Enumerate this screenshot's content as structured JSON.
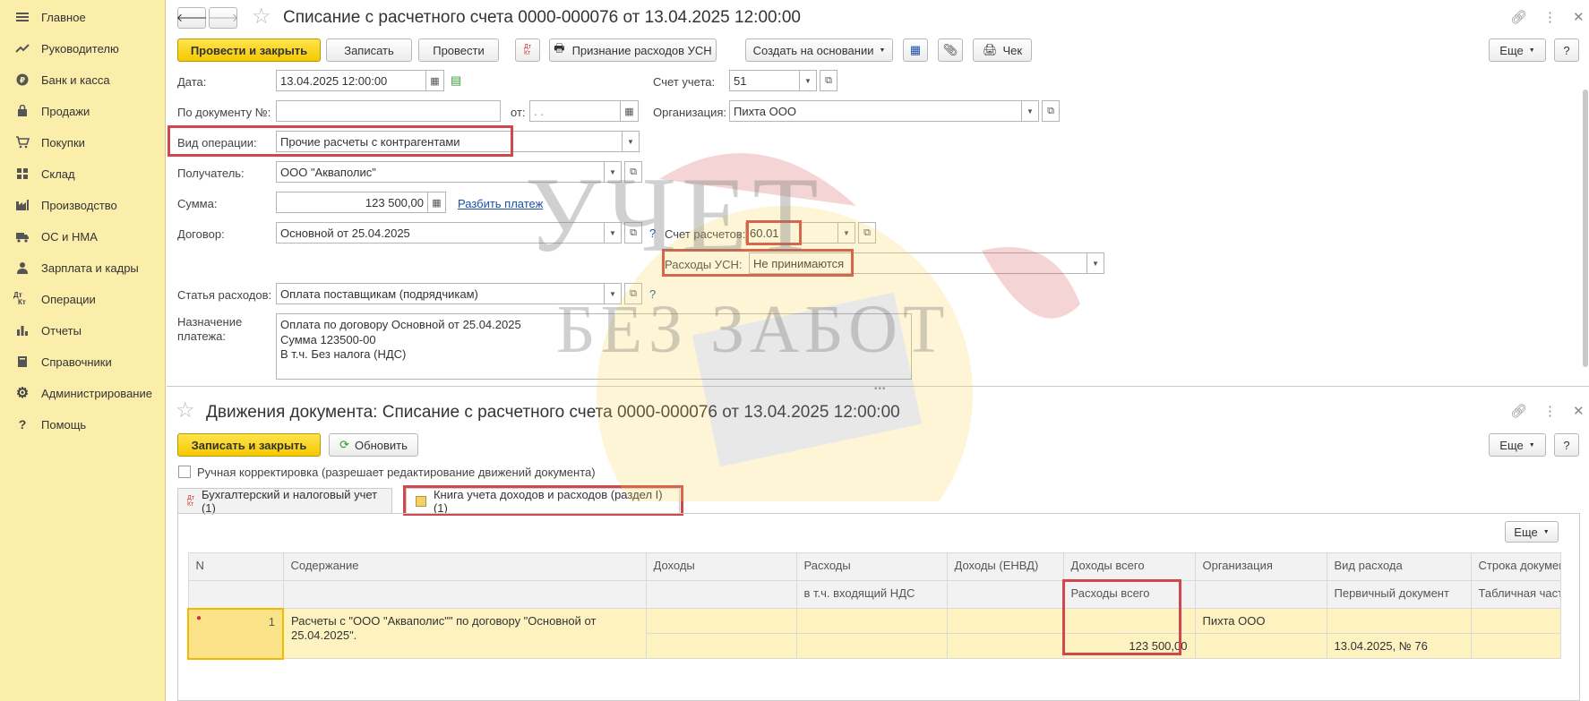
{
  "sidebar": {
    "items": [
      {
        "icon": "menu-lines-icon",
        "label": "Главное"
      },
      {
        "icon": "trend-icon",
        "label": "Руководителю"
      },
      {
        "icon": "ruble-icon",
        "label": "Банк и касса"
      },
      {
        "icon": "bag-icon",
        "label": "Продажи"
      },
      {
        "icon": "cart-icon",
        "label": "Покупки"
      },
      {
        "icon": "warehouse-icon",
        "label": "Склад"
      },
      {
        "icon": "factory-icon",
        "label": "Производство"
      },
      {
        "icon": "truck-icon",
        "label": "ОС и НМА"
      },
      {
        "icon": "person-icon",
        "label": "Зарплата и кадры"
      },
      {
        "icon": "dt-kt-icon",
        "label": "Операции"
      },
      {
        "icon": "bar-chart-icon",
        "label": "Отчеты"
      },
      {
        "icon": "book-icon",
        "label": "Справочники"
      },
      {
        "icon": "gear-icon",
        "label": "Администрирование"
      },
      {
        "icon": "question-icon",
        "label": "Помощь"
      }
    ]
  },
  "doc": {
    "title": "Списание с расчетного счета 0000-000076 от 13.04.2025 12:00:00",
    "toolbar": {
      "post_close": "Провести и закрыть",
      "save": "Записать",
      "post": "Провести",
      "dt_kt": "Дт Кт",
      "usn_print": "Признание расходов УСН",
      "create_based": "Создать на основании",
      "check": "Чек",
      "more": "Еще",
      "help": "?"
    },
    "fields": {
      "date_label": "Дата:",
      "date_value": "13.04.2025 12:00:00",
      "doc_no_label": "По документу №:",
      "doc_no_value": "",
      "from_label": "от:",
      "from_value": " .  .",
      "op_type_label": "Вид операции:",
      "op_type_value": "Прочие расчеты с контрагентами",
      "recipient_label": "Получатель:",
      "recipient_value": "ООО \"Акваполис\"",
      "sum_label": "Сумма:",
      "sum_value": "123 500,00",
      "split_link": "Разбить платеж",
      "contract_label": "Договор:",
      "contract_value": "Основной от 25.04.2025",
      "calc_account_label": "Счет расчетов:",
      "calc_account_value": "60.01",
      "usn_exp_label": "Расходы УСН:",
      "usn_exp_value": "Не принимаются",
      "expense_item_label": "Статья расходов:",
      "expense_item_value": "Оплата поставщикам (подрядчикам)",
      "purpose_label_1": "Назначение",
      "purpose_label_2": "платежа:",
      "purpose_line_1": "Оплата по договору Основной от 25.04.2025",
      "purpose_line_2": "Сумма 123500-00",
      "purpose_line_3": "В т.ч. Без налога (НДС)",
      "account_label": "Счет учета:",
      "account_value": "51",
      "org_label": "Организация:",
      "org_value": "Пихта ООО",
      "question": "?"
    }
  },
  "movements": {
    "title": "Движения документа: Списание с расчетного счета 0000-000076 от 13.04.2025 12:00:00",
    "save_close": "Записать и закрыть",
    "refresh": "Обновить",
    "more": "Еще",
    "help": "?",
    "manual_label": "Ручная корректировка (разрешает редактирование движений документа)",
    "manual_checked": false,
    "tabs": [
      {
        "label": "Бухгалтерский и налоговый учет (1)",
        "icon": "dt-kt-icon"
      },
      {
        "label": "Книга учета доходов и расходов (раздел I) (1)",
        "icon": "ledger-icon",
        "active": true
      }
    ],
    "table_more": "Еще",
    "columns_top": [
      "N",
      "Содержание",
      "Доходы",
      "Расходы",
      "Доходы (ЕНВД)",
      "Доходы всего",
      "Организация",
      "Вид расхода",
      "Строка документ"
    ],
    "columns_sub": [
      "",
      "",
      "",
      "в т.ч. входящий НДС",
      "",
      "Расходы всего",
      "",
      "Первичный документ",
      "Табличная часть"
    ],
    "row": {
      "n": "1",
      "content": "Расчеты с \"ООО \"Акваполис\"\" по договору \"Основной от",
      "content2": "25.04.2025\".",
      "income": "",
      "expenses": "",
      "vat": "",
      "income_envd": "",
      "income_total": "",
      "expenses_total": "123 500,00",
      "org": "Пихта ООО",
      "exp_type": "",
      "primary_doc": "13.04.2025, № 76",
      "table_part": ""
    }
  },
  "watermark": {
    "line1": "УЧЕТ",
    "line2": "БЕЗ ЗАБОТ"
  },
  "colors": {
    "sidebar_bg": "#fbedaa",
    "accent_yellow": "#f5c800",
    "highlight_red": "#d0474e",
    "link_blue": "#1c50a6"
  }
}
